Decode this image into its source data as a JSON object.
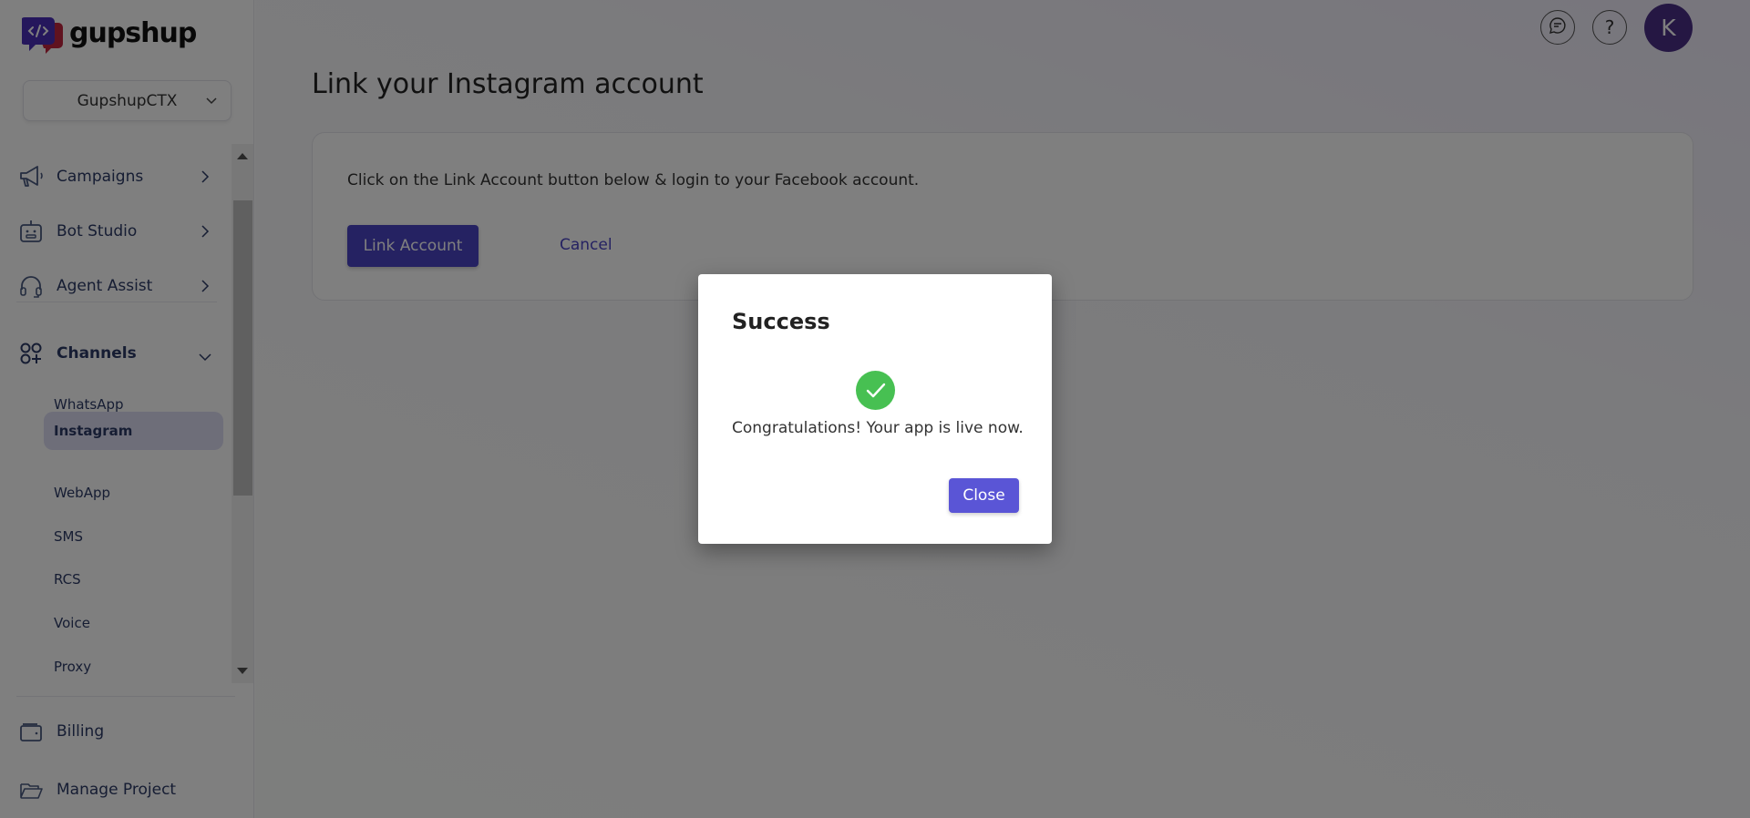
{
  "brand": {
    "name": "gupshup"
  },
  "project_selector": {
    "value": "GupshupCTX",
    "icon": "chevron-down-icon"
  },
  "sidebar": {
    "items": [
      {
        "label": "Campaigns",
        "icon": "megaphone-icon",
        "arrow": "chevron-right-icon"
      },
      {
        "label": "Bot Studio",
        "icon": "robot-icon",
        "arrow": "chevron-right-icon"
      },
      {
        "label": "Agent Assist",
        "icon": "headset-icon",
        "arrow": "chevron-right-icon"
      },
      {
        "label": "Channels",
        "icon": "channels-icon",
        "arrow": "chevron-down-icon",
        "expanded": true
      }
    ],
    "channels": [
      {
        "label": "WhatsApp",
        "active": false
      },
      {
        "label": "Instagram",
        "active": true
      },
      {
        "label": "WebApp",
        "active": false
      },
      {
        "label": "SMS",
        "active": false
      },
      {
        "label": "RCS",
        "active": false
      },
      {
        "label": "Voice",
        "active": false
      },
      {
        "label": "Proxy",
        "active": false
      }
    ],
    "bottom_items": [
      {
        "label": "Billing",
        "icon": "wallet-icon"
      },
      {
        "label": "Manage Project",
        "icon": "folder-icon"
      }
    ]
  },
  "header": {
    "icons": [
      "chat-support-icon",
      "help-icon"
    ],
    "avatar_initial": "K"
  },
  "main": {
    "title": "Link your Instagram account",
    "instruction": "Click on the Link Account button below & login to your Facebook account.",
    "link_button": "Link Account",
    "cancel_link": "Cancel"
  },
  "modal": {
    "title": "Success",
    "icon": "check-circle-icon",
    "message": "Congratulations! Your app is live now.",
    "close_button": "Close"
  },
  "colors": {
    "primary": "#4a44c4",
    "modal_button": "#5a55d6",
    "success": "#47c052",
    "avatar": "#4a2f86",
    "nav_text": "#2c3a66",
    "active_item_bg": "#dcdcf3"
  }
}
